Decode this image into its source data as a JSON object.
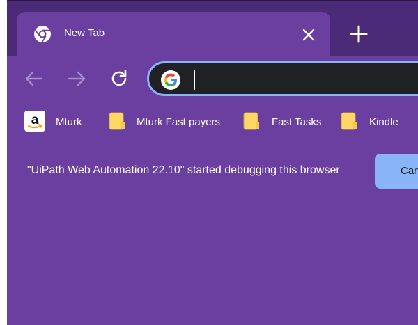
{
  "tab": {
    "title": "New Tab",
    "close_icon": "close-icon",
    "favicon": "chrome-icon"
  },
  "new_tab_icon": "plus-icon",
  "toolbar": {
    "back_icon": "arrow-left-icon",
    "forward_icon": "arrow-right-icon",
    "reload_icon": "reload-icon"
  },
  "omnibox": {
    "value": "",
    "icon": "google-icon"
  },
  "bookmarks": [
    {
      "label": "Mturk",
      "icon": "amazon-icon"
    },
    {
      "label": "Mturk Fast payers",
      "icon": "folder-icon"
    },
    {
      "label": "Fast Tasks",
      "icon": "folder-icon"
    },
    {
      "label": "Kindle",
      "icon": "folder-icon"
    }
  ],
  "infobar": {
    "message": "\"UiPath Web Automation 22.10\" started debugging this browser",
    "button_label": "Can"
  },
  "colors": {
    "theme": "#6b3fa0",
    "tabstrip": "#4b2a77",
    "accent": "#8ab4f8",
    "omnibox_bg": "#202124"
  }
}
